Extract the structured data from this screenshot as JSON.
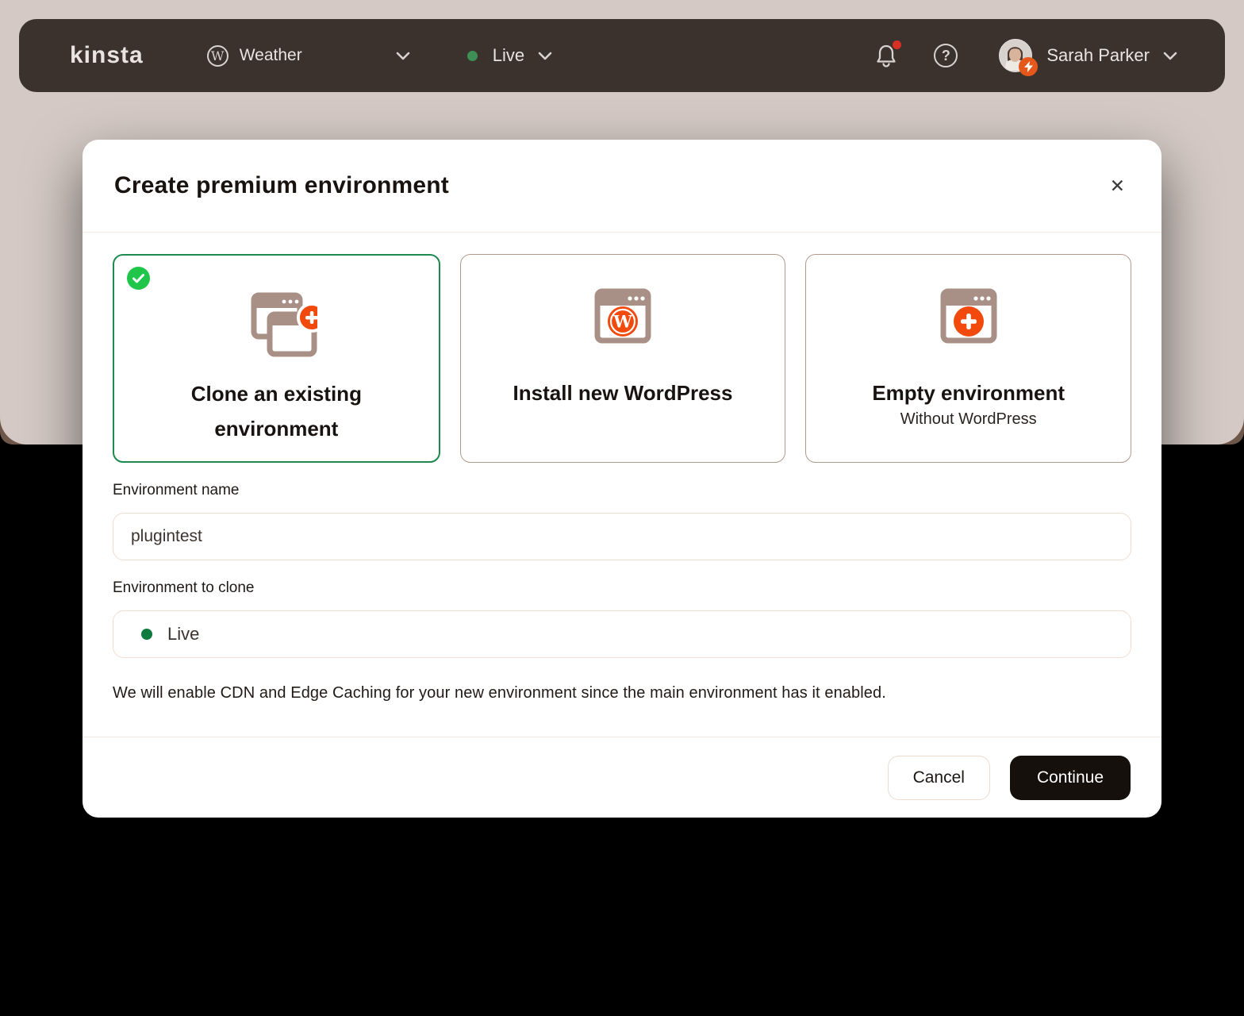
{
  "navbar": {
    "logo": "kinsta",
    "site_selector": {
      "label": "Weather"
    },
    "env_selector": {
      "label": "Live",
      "status_color": "#3e8f53"
    },
    "notifications": {
      "unread": true,
      "badge_color": "#d93025"
    },
    "user": {
      "name": "Sarah Parker"
    }
  },
  "modal": {
    "title": "Create premium environment",
    "options": [
      {
        "title": "Clone an existing environment",
        "selected": true
      },
      {
        "title": "Install new WordPress",
        "selected": false
      },
      {
        "title": "Empty environment",
        "subtitle": "Without WordPress",
        "selected": false
      }
    ],
    "form": {
      "env_name": {
        "label": "Environment name",
        "value": "plugintest"
      },
      "env_clone": {
        "label": "Environment to clone",
        "value": "Live",
        "status_color": "#0d7a3e"
      }
    },
    "info_text": "We will enable CDN and Edge Caching for your new environment since the main environment has it enabled.",
    "footer": {
      "cancel_label": "Cancel",
      "continue_label": "Continue"
    }
  },
  "icons": {
    "close": "✕",
    "help": "?",
    "wordpress_mark": "W"
  },
  "colors": {
    "accent_orange": "#f2490c",
    "selected_green": "#1d8a4e",
    "check_green": "#1fc64a",
    "navbar_bg": "#3b312d",
    "hero_bg": "#d4c9c4",
    "icon_taupe": "#a89086"
  }
}
